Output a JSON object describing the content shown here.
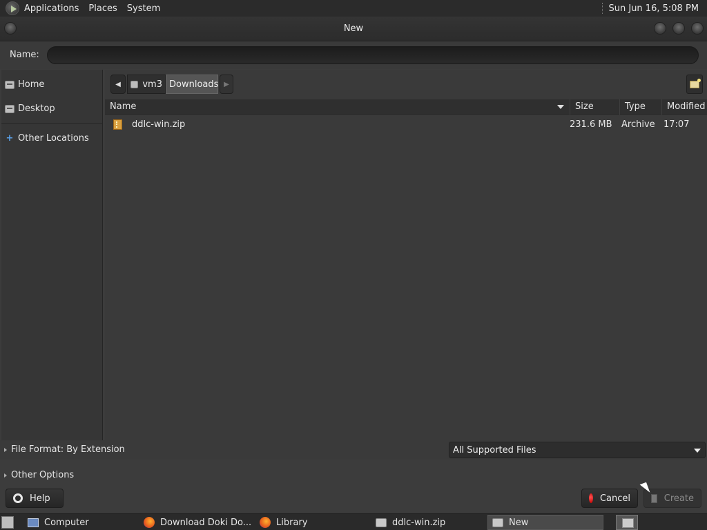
{
  "top_panel": {
    "menus": [
      "Applications",
      "Places",
      "System"
    ],
    "clock": "Sun Jun 16,  5:08 PM"
  },
  "dialog": {
    "title": "New",
    "name_label": "Name:",
    "name_value": "",
    "sidebar": {
      "home": "Home",
      "desktop": "Desktop",
      "other_locations": "Other Locations"
    },
    "pathbar": {
      "segments": [
        "vm3",
        "Downloads"
      ]
    },
    "columns": {
      "name": "Name",
      "size": "Size",
      "type": "Type",
      "modified": "Modified"
    },
    "files": [
      {
        "name": "ddlc-win.zip",
        "size": "231.6 MB",
        "type": "Archive",
        "modified": "17:07"
      }
    ],
    "file_format_label": "File Format: By Extension",
    "filter_combo": "All Supported Files",
    "other_options_label": "Other Options",
    "buttons": {
      "help": "Help",
      "cancel": "Cancel",
      "create": "Create"
    }
  },
  "taskbar": {
    "tasks": [
      "Computer",
      "Download Doki Do...",
      "Library",
      "ddlc-win.zip",
      "New"
    ]
  }
}
